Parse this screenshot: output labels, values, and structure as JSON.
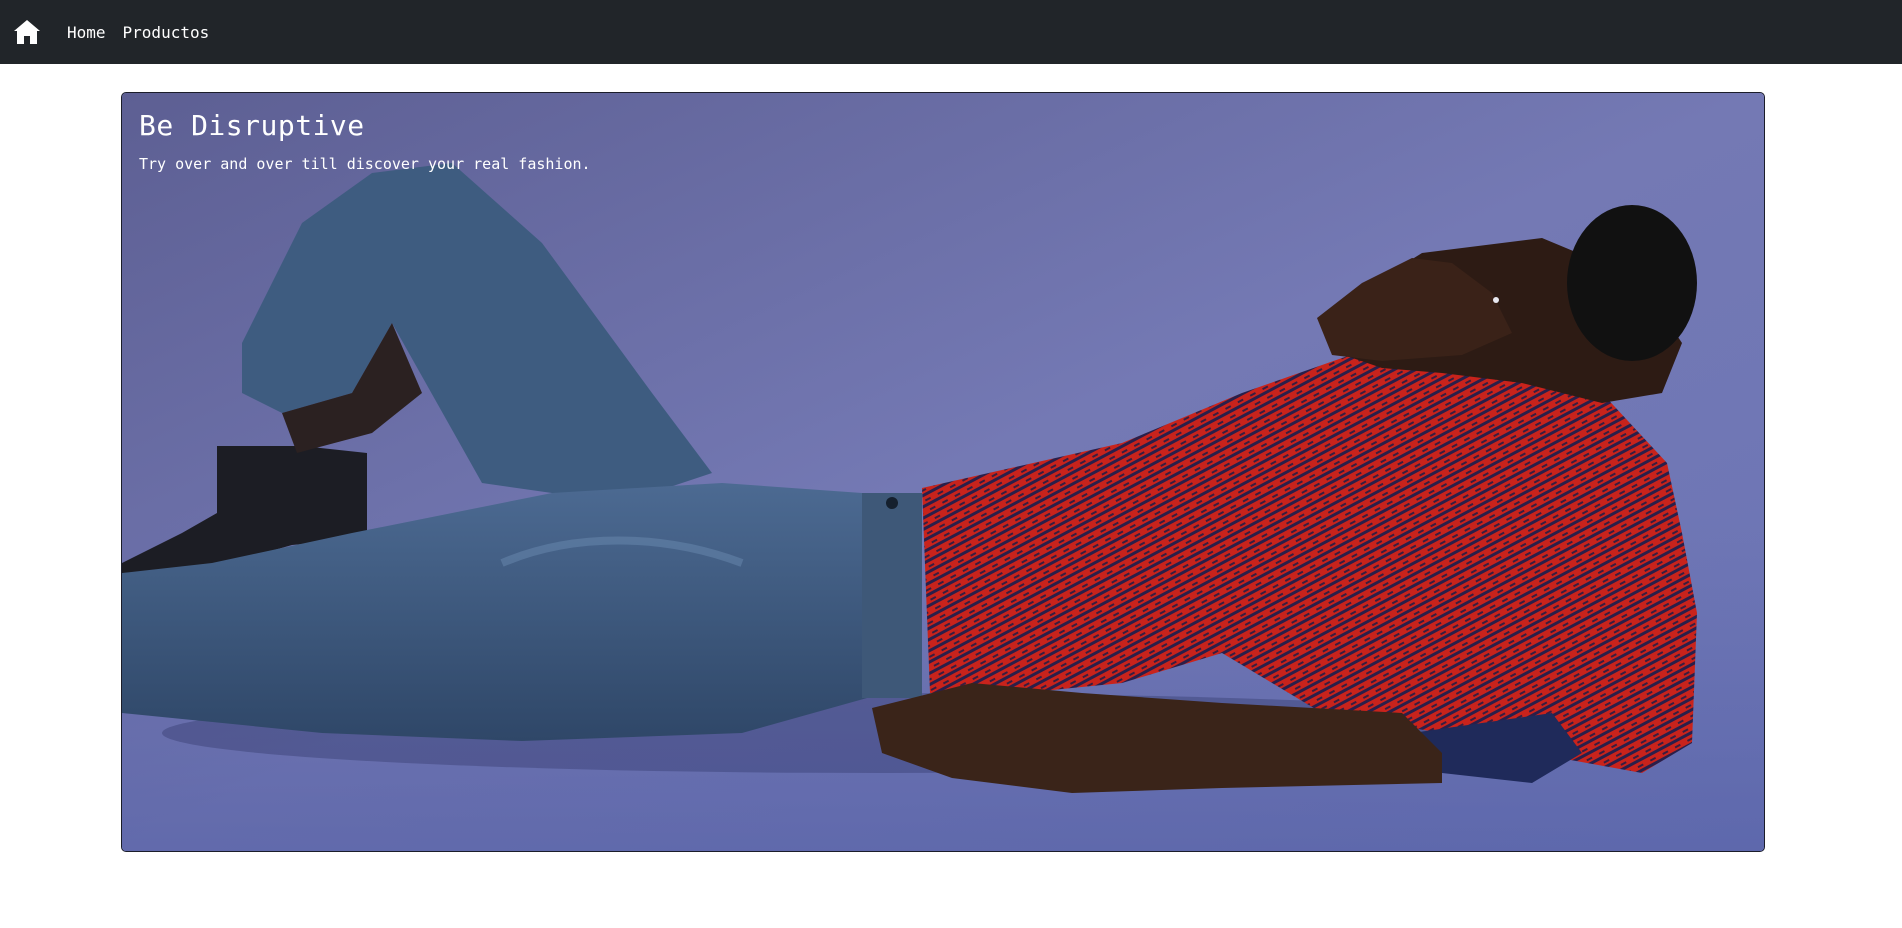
{
  "navbar": {
    "brand_icon": "home-icon",
    "links": [
      {
        "label": "Home"
      },
      {
        "label": "Productos"
      }
    ],
    "background": "#212529"
  },
  "hero": {
    "title": "Be Disruptive",
    "subtitle": "Try over and over till discover your real fashion.",
    "image": "man-lying-on-floor-red-sweater-photo",
    "colors": {
      "backdrop": "#6b6fa8",
      "sweater": "#c4221c",
      "trousers": "#3f5d85"
    }
  }
}
